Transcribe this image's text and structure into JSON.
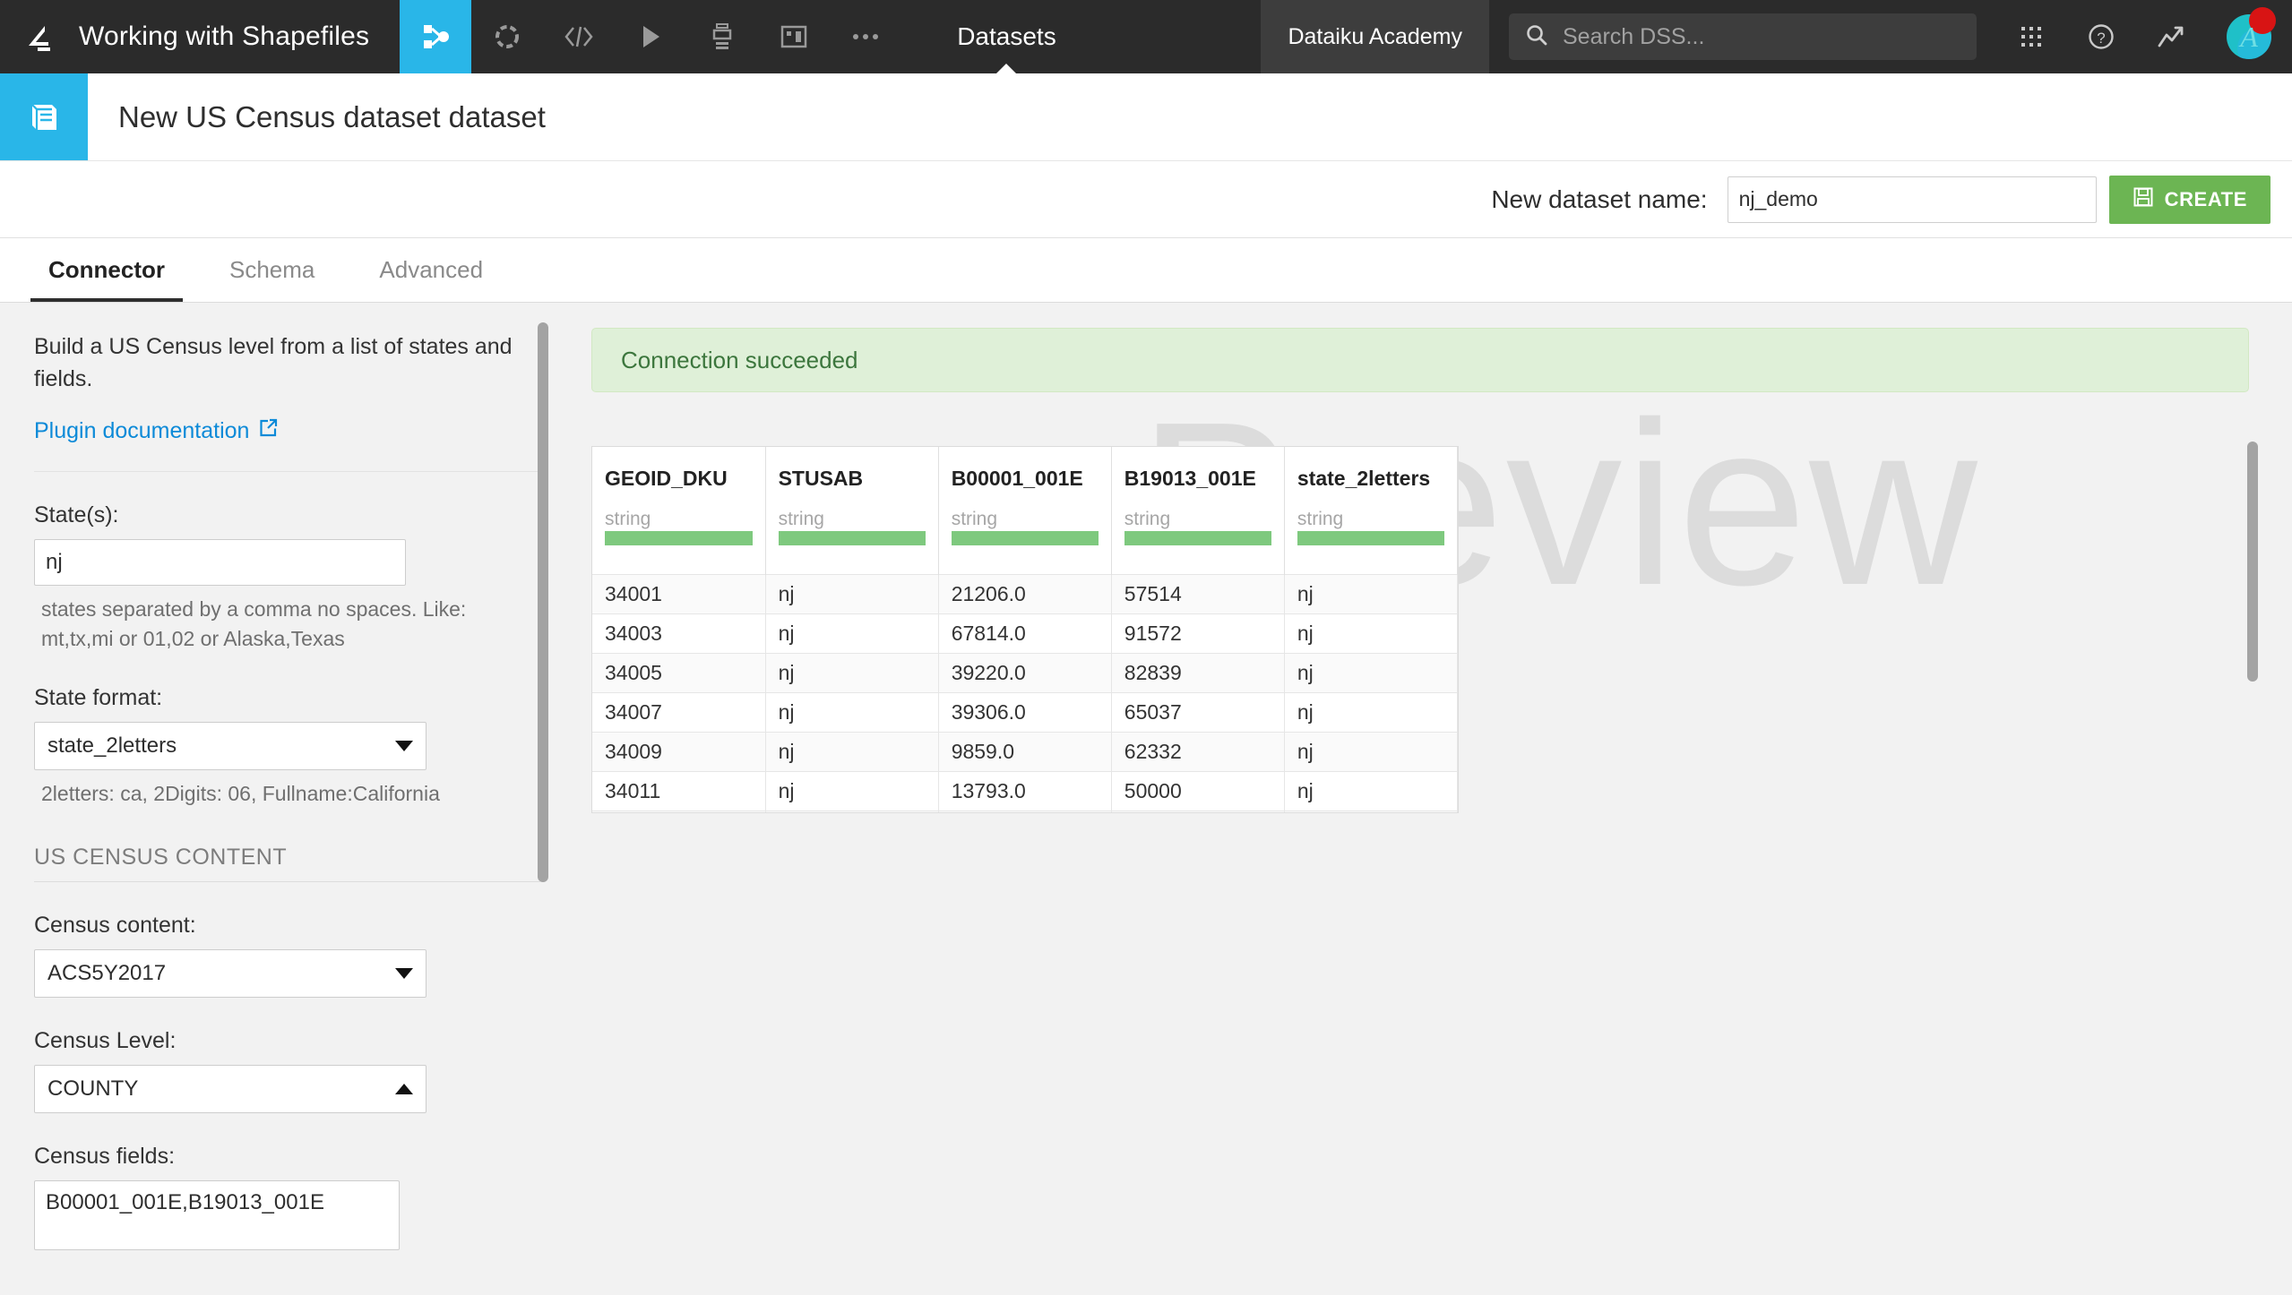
{
  "topbar": {
    "project_name": "Working with Shapefiles",
    "logo_icon": "dataiku-bird-logo-icon",
    "nav_items": [
      {
        "icon": "flow-branch-icon",
        "name": "flow",
        "active": true
      },
      {
        "icon": "lab-circle-icon",
        "name": "lab",
        "active": false
      },
      {
        "icon": "code-icon",
        "name": "code",
        "active": false
      },
      {
        "icon": "play-icon",
        "name": "automation",
        "active": false
      },
      {
        "icon": "jobs-stack-icon",
        "name": "jobs",
        "active": false
      },
      {
        "icon": "dashboard-icon",
        "name": "dashboards",
        "active": false
      },
      {
        "icon": "more-ellipsis-icon",
        "name": "more",
        "active": false
      }
    ],
    "datasets_label": "Datasets",
    "academy_label": "Dataiku Academy",
    "search_placeholder": "Search DSS...",
    "apps_icon": "grid-apps-icon",
    "help_icon": "help-question-icon",
    "metrics_icon": "trend-arrow-icon",
    "avatar_letter": "A",
    "notification_dot": true,
    "colors": {
      "bar_bg": "#2b2b2b",
      "accent": "#29b6e8"
    }
  },
  "header": {
    "dataset_icon": "dataset-book-icon",
    "title": "New US Census dataset dataset"
  },
  "name_row": {
    "label": "New dataset name:",
    "value": "nj_demo",
    "placeholder": "",
    "create_label": "CREATE",
    "create_icon": "save-floppy-icon",
    "create_color": "#6cb553"
  },
  "tabs": [
    {
      "label": "Connector",
      "active": true
    },
    {
      "label": "Schema",
      "active": false
    },
    {
      "label": "Advanced",
      "active": false
    }
  ],
  "sidebar": {
    "description": "Build a US Census level from a list of states and fields.",
    "doc_link": "Plugin documentation",
    "doc_link_icon": "external-link-icon",
    "states": {
      "label": "State(s):",
      "value": "nj",
      "help": "states separated by a comma no spaces. Like: mt,tx,mi or 01,02 or Alaska,Texas"
    },
    "state_format": {
      "label": "State format:",
      "value": "state_2letters",
      "caret": "down",
      "help": "2letters: ca, 2Digits: 06, Fullname:California"
    },
    "section_title": "US CENSUS CONTENT",
    "census_content": {
      "label": "Census content:",
      "value": "ACS5Y2017",
      "caret": "down"
    },
    "census_level": {
      "label": "Census Level:",
      "value": "COUNTY",
      "caret": "up"
    },
    "census_fields": {
      "label": "Census fields:",
      "value": "B00001_001E,B19013_001E"
    }
  },
  "main": {
    "alert": "Connection succeeded",
    "watermark": "Preview",
    "table": {
      "columns": [
        {
          "name": "GEOID_DKU",
          "type": "string"
        },
        {
          "name": "STUSAB",
          "type": "string"
        },
        {
          "name": "B00001_001E",
          "type": "string"
        },
        {
          "name": "B19013_001E",
          "type": "string"
        },
        {
          "name": "state_2letters",
          "type": "string"
        }
      ],
      "rows": [
        [
          "34001",
          "nj",
          "21206.0",
          "57514",
          "nj"
        ],
        [
          "34003",
          "nj",
          "67814.0",
          "91572",
          "nj"
        ],
        [
          "34005",
          "nj",
          "39220.0",
          "82839",
          "nj"
        ],
        [
          "34007",
          "nj",
          "39306.0",
          "65037",
          "nj"
        ],
        [
          "34009",
          "nj",
          "9859.0",
          "62332",
          "nj"
        ],
        [
          "34011",
          "nj",
          "13793.0",
          "50000",
          "nj"
        ]
      ]
    }
  }
}
